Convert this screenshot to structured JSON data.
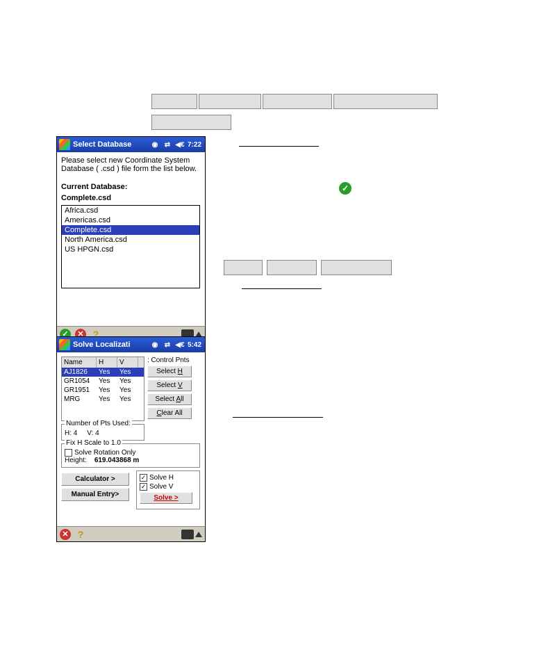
{
  "device1": {
    "title": "Select Database",
    "time": "7:22",
    "prompt": "Please select new Coordinate System Database ( .csd ) file form the list below.",
    "current_label": "Current Database:",
    "current_value": "Complete.csd",
    "items": [
      "Africa.csd",
      "Americas.csd",
      "Complete.csd",
      "North America.csd",
      "US HPGN.csd"
    ],
    "selected_index": 2
  },
  "device2": {
    "title": "Solve Localizati",
    "time": "5:42",
    "grid_headers": {
      "name": "Name",
      "h": "H",
      "v": "V"
    },
    "rows": [
      {
        "name": "AJ1826",
        "h": "Yes",
        "v": "Yes"
      },
      {
        "name": "GR1054",
        "h": "Yes",
        "v": "Yes"
      },
      {
        "name": "GR1951",
        "h": "Yes",
        "v": "Yes"
      },
      {
        "name": "MRG",
        "h": "Yes",
        "v": "Yes"
      }
    ],
    "selected_row_index": 0,
    "control_pnts_label": ": Control Pnts",
    "buttons": {
      "select_h": "Select H",
      "select_v": "Select V",
      "select_all": "Select All",
      "clear_all": "Clear All"
    },
    "num_pts": {
      "legend": "Number of Pts Used:",
      "h_label": "H:",
      "h_val": "4",
      "v_label": "V:",
      "v_val": "4"
    },
    "fix_scale": {
      "legend": "Fix H Scale to 1.0",
      "solve_rot_label": "Solve Rotation Only",
      "solve_rot_checked": false,
      "height_label": "Height:",
      "height_val": "619.043868 m"
    },
    "bottom": {
      "calculator": "Calculator >",
      "manual": "Manual Entry>",
      "solve_h_label": "Solve H",
      "solve_h_checked": true,
      "solve_v_label": "Solve V",
      "solve_v_checked": true,
      "solve_btn": "Solve >"
    }
  }
}
